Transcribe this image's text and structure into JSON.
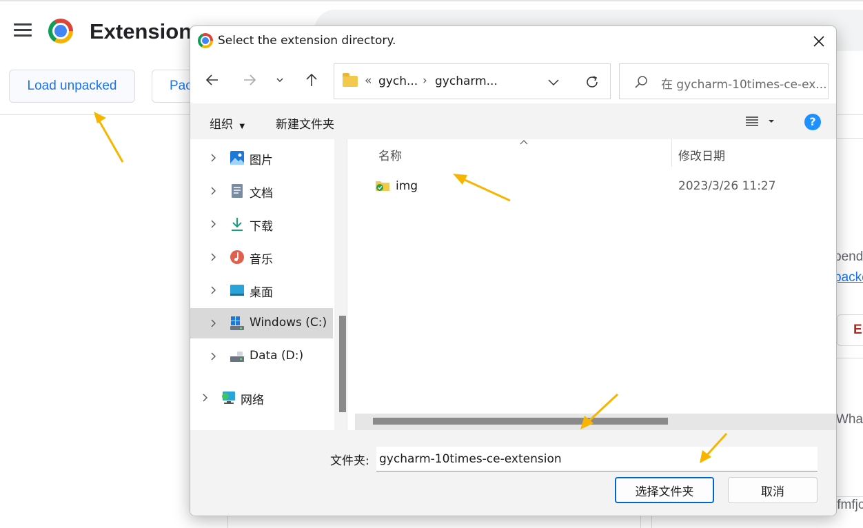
{
  "background": {
    "page_title": "Extension",
    "load_unpacked": "Load unpacked",
    "pack_button": "Pac",
    "fragment_1": "pend",
    "fragment_2": "packe",
    "fragment_err": "Er",
    "fragment_what": "What",
    "fragment_id": "ifmfjc"
  },
  "dialog": {
    "title": "Select the extension directory.",
    "breadcrumb": {
      "overflow": "«",
      "parts": [
        "gych...",
        "gycharm..."
      ]
    },
    "search_placeholder": "在 gycharm-10times-ce-ex...",
    "toolbar": {
      "organize": "组织",
      "new_folder": "新建文件夹"
    },
    "nav_items": [
      {
        "label": "图片",
        "icon": "pictures-icon"
      },
      {
        "label": "文档",
        "icon": "documents-icon"
      },
      {
        "label": "下载",
        "icon": "downloads-icon"
      },
      {
        "label": "音乐",
        "icon": "music-icon"
      },
      {
        "label": "桌面",
        "icon": "desktop-icon"
      },
      {
        "label": "Windows (C:)",
        "icon": "windows-drive-icon",
        "selected": true
      },
      {
        "label": "Data (D:)",
        "icon": "data-drive-icon"
      },
      {
        "label": "网络",
        "icon": "network-icon"
      }
    ],
    "columns": {
      "name": "名称",
      "modified": "修改日期"
    },
    "files": [
      {
        "name": "img",
        "modified": "2023/3/26 11:27"
      }
    ],
    "folder_label": "文件夹:",
    "folder_value": "gycharm-10times-ce-extension",
    "select_button": "选择文件夹",
    "cancel_button": "取消"
  },
  "colors": {
    "accent_blue": "#1a73e8",
    "annotation_arrow": "#f7b500",
    "selection_bg": "#d9d9d9"
  }
}
